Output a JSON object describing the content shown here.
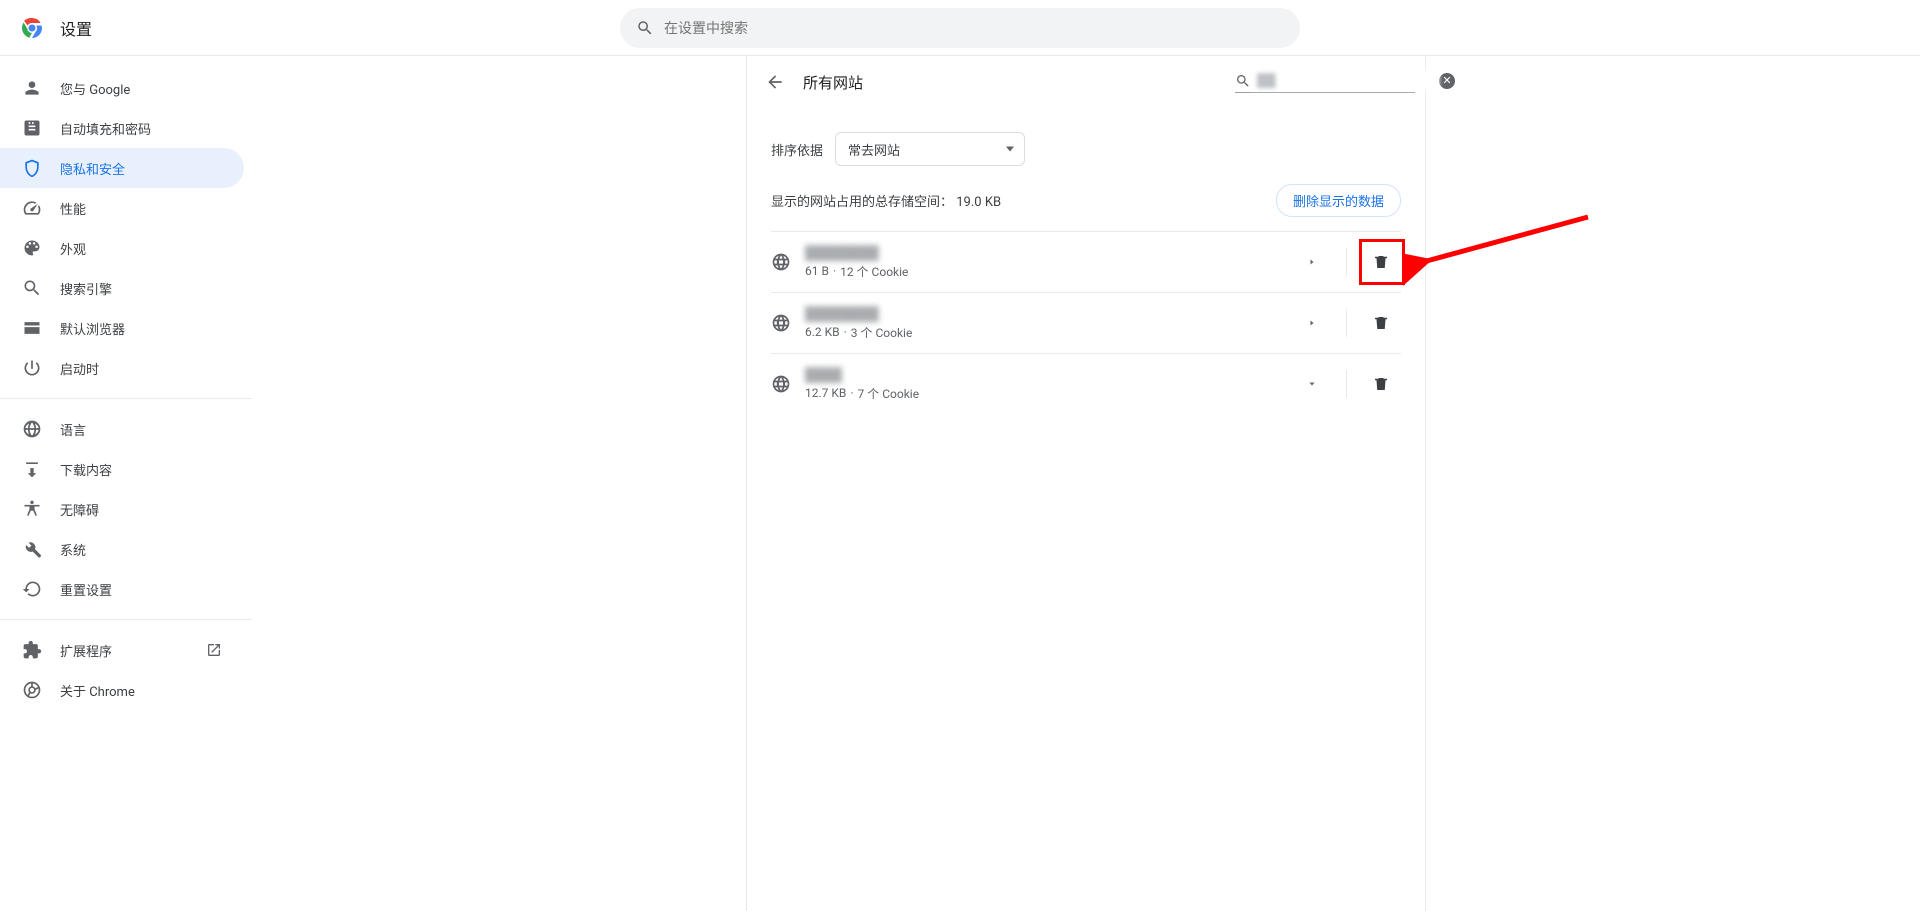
{
  "header": {
    "title": "设置",
    "search_placeholder": "在设置中搜索"
  },
  "sidebar": {
    "items": [
      {
        "label": "您与 Google"
      },
      {
        "label": "自动填充和密码"
      },
      {
        "label": "隐私和安全"
      },
      {
        "label": "性能"
      },
      {
        "label": "外观"
      },
      {
        "label": "搜索引擎"
      },
      {
        "label": "默认浏览器"
      },
      {
        "label": "启动时"
      }
    ],
    "items2": [
      {
        "label": "语言"
      },
      {
        "label": "下载内容"
      },
      {
        "label": "无障碍"
      },
      {
        "label": "系统"
      },
      {
        "label": "重置设置"
      }
    ],
    "items3": [
      {
        "label": "扩展程序"
      },
      {
        "label": "关于 Chrome"
      }
    ]
  },
  "content": {
    "page_title": "所有网站",
    "search_value": "",
    "sort_label": "排序依据",
    "sort_value": "常去网站",
    "storage_prefix": "显示的网站占用的总存储空间：",
    "storage_total": "19.0 KB",
    "clear_displayed": "删除显示的数据",
    "sites": [
      {
        "name": "████████",
        "size": "61 B",
        "cookies": "12 个 Cookie",
        "arrow": "right"
      },
      {
        "name": "████████",
        "size": "6.2 KB",
        "cookies": "3 个 Cookie",
        "arrow": "right"
      },
      {
        "name": "████",
        "size": "12.7 KB",
        "cookies": "7 个 Cookie",
        "arrow": "down"
      }
    ],
    "dot": "·"
  }
}
